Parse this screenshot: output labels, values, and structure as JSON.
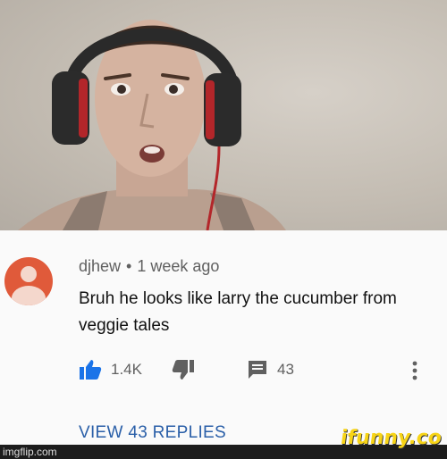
{
  "comment": {
    "author": "djhew",
    "separator": "•",
    "time": "1 week ago",
    "text": "Bruh he looks like larry the cucumber from veggie tales",
    "likes": "1.4K",
    "reply_count": "43",
    "view_replies": "VIEW 43 REPLIES"
  },
  "watermarks": {
    "imgflip": "imgflip.com",
    "ifunny": "ifunny.co"
  },
  "colors": {
    "like_icon": "#1a73e8",
    "avatar_bg": "#e05a3a",
    "link": "#2a5fa8"
  },
  "icons": {
    "like": "thumbs-up-icon",
    "dislike": "thumbs-down-icon",
    "reply": "comment-icon",
    "more": "more-vertical-icon"
  }
}
